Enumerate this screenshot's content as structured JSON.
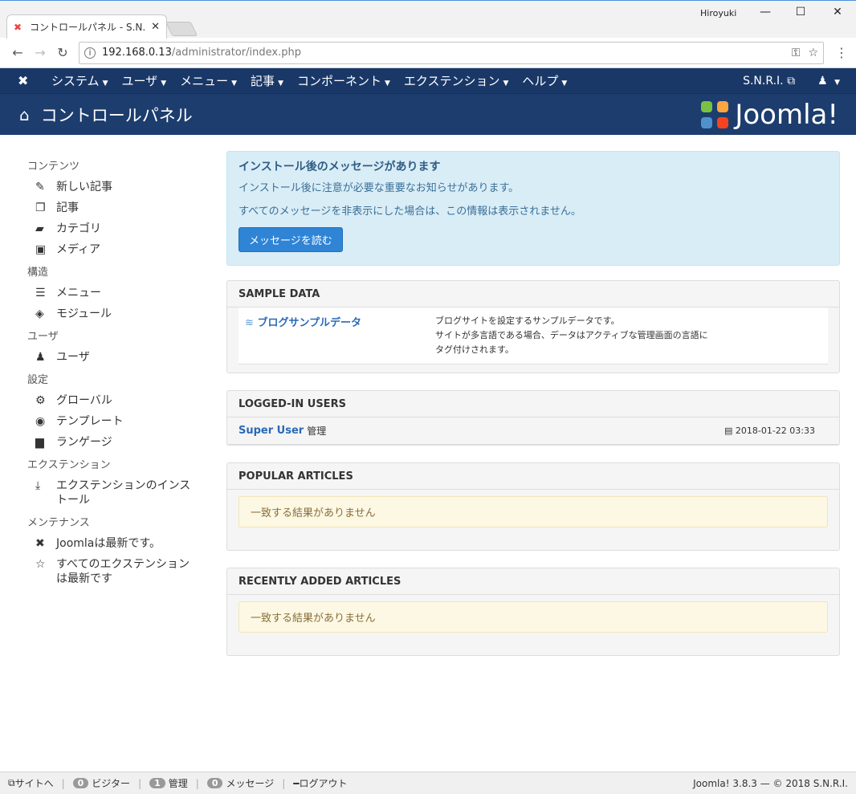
{
  "browser": {
    "tab_title": "コントロールパネル - S.N.R.I.",
    "profile_name": "Hiroyuki",
    "url_host": "192.168.0.13",
    "url_path": "/administrator/index.php"
  },
  "topnav": {
    "items": [
      "システム",
      "ユーザ",
      "メニュー",
      "記事",
      "コンポーネント",
      "エクステンション",
      "ヘルプ"
    ],
    "site_link": "S.N.R.I."
  },
  "header": {
    "title": "コントロールパネル",
    "brand": "Joomla!"
  },
  "sidebar": {
    "sections": [
      {
        "heading": "コンテンツ",
        "items": [
          {
            "icon": "pencil-icon",
            "glyph": "✎",
            "label": "新しい記事"
          },
          {
            "icon": "stack-icon",
            "glyph": "❐",
            "label": "記事"
          },
          {
            "icon": "folder-icon",
            "glyph": "▰",
            "label": "カテゴリ"
          },
          {
            "icon": "image-icon",
            "glyph": "▣",
            "label": "メディア"
          }
        ]
      },
      {
        "heading": "構造",
        "items": [
          {
            "icon": "list-icon",
            "glyph": "☰",
            "label": "メニュー"
          },
          {
            "icon": "cube-icon",
            "glyph": "◈",
            "label": "モジュール"
          }
        ]
      },
      {
        "heading": "ユーザ",
        "items": [
          {
            "icon": "users-icon",
            "glyph": "♟",
            "label": "ユーザ"
          }
        ]
      },
      {
        "heading": "設定",
        "items": [
          {
            "icon": "cog-icon",
            "glyph": "⚙",
            "label": "グローバル"
          },
          {
            "icon": "eye-icon",
            "glyph": "◉",
            "label": "テンプレート"
          },
          {
            "icon": "comments-icon",
            "glyph": "▆",
            "label": "ランゲージ"
          }
        ]
      },
      {
        "heading": "エクステンション",
        "items": [
          {
            "icon": "download-icon",
            "glyph": "⤓",
            "label": "エクステンションのインストール"
          }
        ]
      },
      {
        "heading": "メンテナンス",
        "items": [
          {
            "icon": "joomla-icon",
            "glyph": "✖",
            "label": "Joomlaは最新です。"
          },
          {
            "icon": "star-icon",
            "glyph": "☆",
            "label": "すべてのエクステンションは最新です"
          }
        ]
      }
    ]
  },
  "alert": {
    "heading": "インストール後のメッセージがあります",
    "line1": "インストール後に注意が必要な重要なお知らせがあります。",
    "line2": "すべてのメッセージを非表示にした場合は、この情報は表示されません。",
    "button": "メッセージを読む"
  },
  "sample_data": {
    "heading": "SAMPLE DATA",
    "name": "ブログサンプルデータ",
    "desc1": "ブログサイトを設定するサンプルデータです。",
    "desc2": "サイトが多言語である場合、データはアクティブな管理画面の言語に",
    "desc3": "タグ付けされます。"
  },
  "logged_in": {
    "heading": "LOGGED-IN USERS",
    "user": "Super User",
    "role": "管理",
    "date": "2018-01-22 03:33"
  },
  "popular": {
    "heading": "POPULAR ARTICLES",
    "empty": "一致する結果がありません"
  },
  "recent": {
    "heading": "RECENTLY ADDED ARTICLES",
    "empty": "一致する結果がありません"
  },
  "footer": {
    "site": "サイトへ",
    "visitors_count": "0",
    "visitors": "ビジター",
    "admin_count": "1",
    "admin": "管理",
    "messages_count": "0",
    "messages": "メッセージ",
    "logout": "ログアウト",
    "version": "Joomla! 3.8.3 — © 2018 S.N.R.I."
  }
}
